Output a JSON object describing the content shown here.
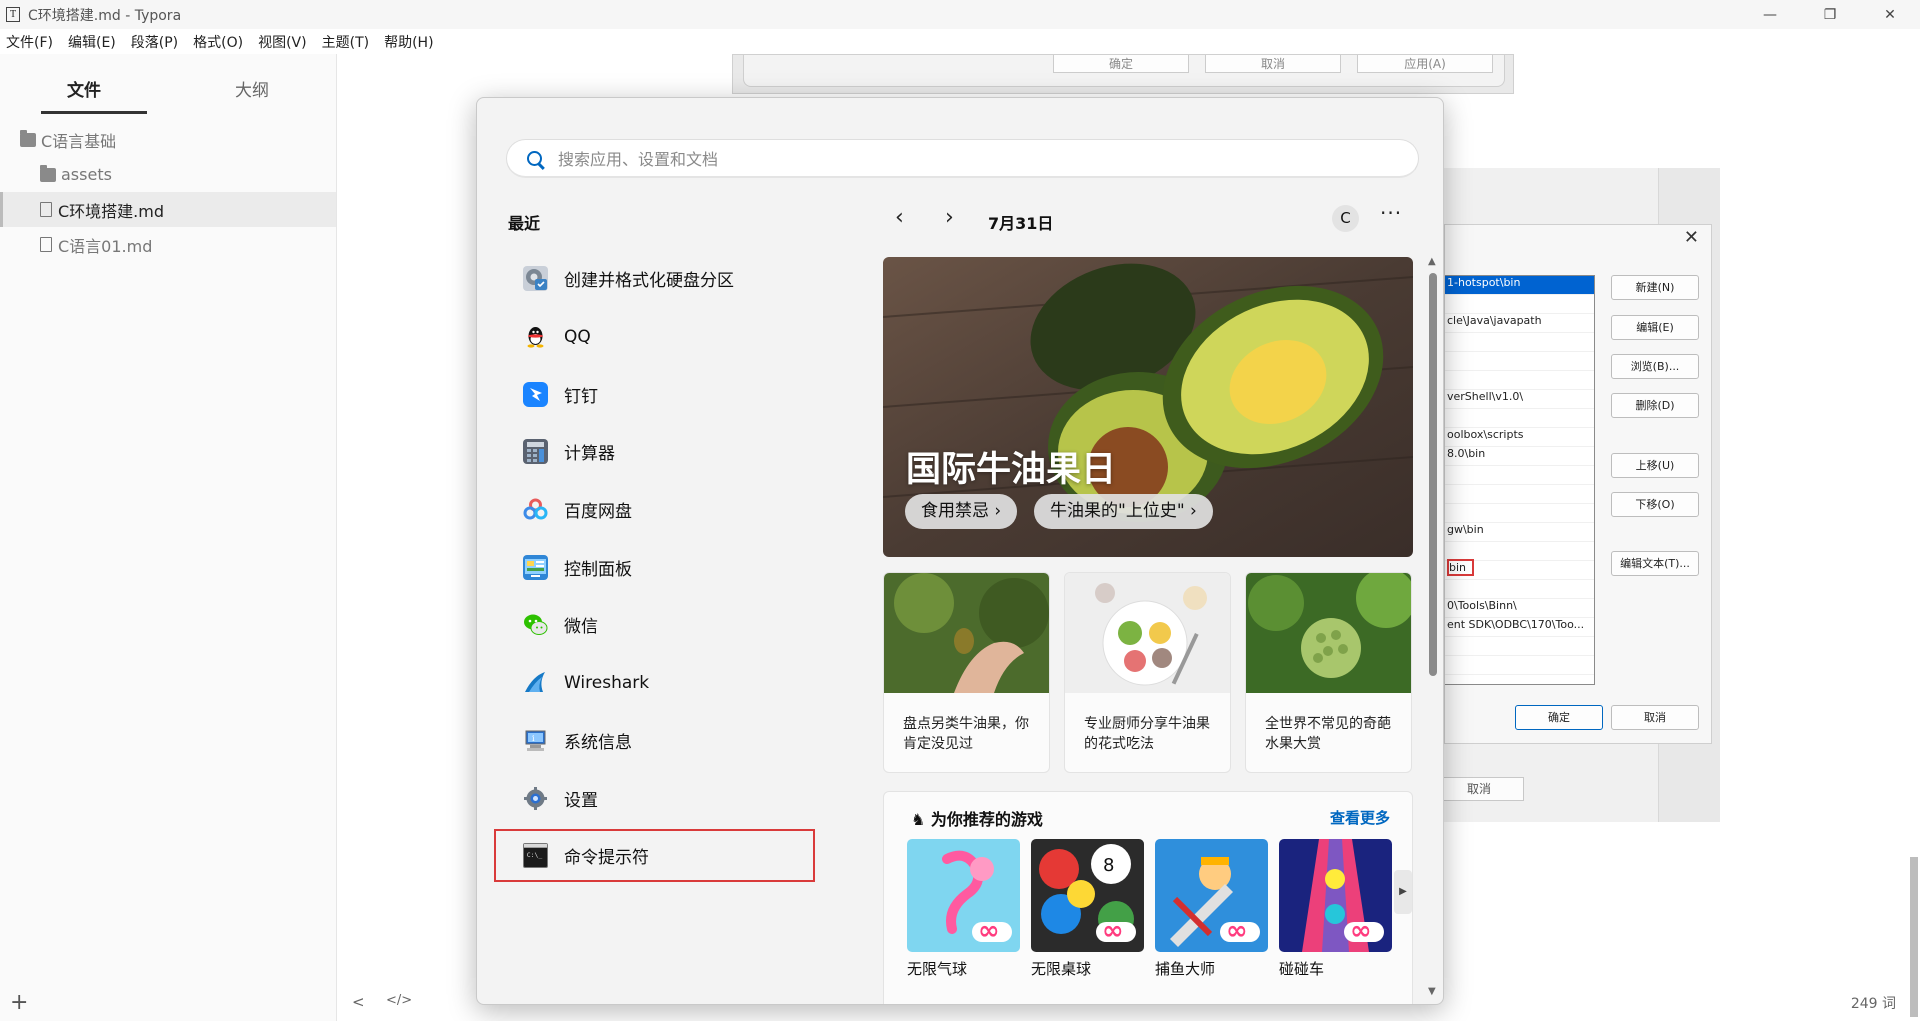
{
  "window": {
    "icon_letter": "T",
    "title": "C环境搭建.md - Typora",
    "minimize": "—",
    "maximize": "❐",
    "close": "✕"
  },
  "menu": [
    "文件(F)",
    "编辑(E)",
    "段落(P)",
    "格式(O)",
    "视图(V)",
    "主题(T)",
    "帮助(H)"
  ],
  "sidebar": {
    "tabs": [
      "文件",
      "大纲"
    ],
    "tree": [
      {
        "label": "C语言基础",
        "type": "folder"
      },
      {
        "label": "assets",
        "type": "folder"
      },
      {
        "label": "C环境搭建.md",
        "type": "file",
        "active": true
      },
      {
        "label": "C语言01.md",
        "type": "file"
      }
    ],
    "add": "+"
  },
  "statusbar": {
    "back": "<",
    "source": "</>",
    "word_count": "249 词"
  },
  "background": {
    "dialog_buttons": [
      "确定",
      "取消",
      "应用(A)"
    ],
    "env": {
      "rows": [
        "1-hotspot\\bin",
        "",
        "cle\\Java\\javapath",
        "",
        "",
        "",
        "verShell\\v1.0\\",
        "",
        "oolbox\\scripts",
        "8.0\\bin",
        "",
        "",
        "",
        "gw\\bin",
        "",
        "bin",
        "",
        "0\\Tools\\Binn\\",
        "ent SDK\\ODBC\\170\\Too...",
        "",
        ""
      ],
      "buttons": [
        "新建(N)",
        "编辑(E)",
        "浏览(B)...",
        "删除(D)",
        "上移(U)",
        "下移(O)",
        "编辑文本(T)..."
      ],
      "ok": "确定",
      "cancel": "取消"
    },
    "back_cancel": "取消"
  },
  "start": {
    "search_placeholder": "搜索应用、设置和文档",
    "recent_title": "最近",
    "apps": [
      {
        "label": "创建并格式化硬盘分区",
        "icon": "disk-management-icon"
      },
      {
        "label": "QQ",
        "icon": "qq-icon"
      },
      {
        "label": "钉钉",
        "icon": "dingtalk-icon"
      },
      {
        "label": "计算器",
        "icon": "calculator-icon"
      },
      {
        "label": "百度网盘",
        "icon": "baidu-netdisk-icon"
      },
      {
        "label": "控制面板",
        "icon": "control-panel-icon"
      },
      {
        "label": "微信",
        "icon": "wechat-icon"
      },
      {
        "label": "Wireshark",
        "icon": "wireshark-icon"
      },
      {
        "label": "系统信息",
        "icon": "system-info-icon"
      },
      {
        "label": "设置",
        "icon": "settings-icon"
      },
      {
        "label": "命令提示符",
        "icon": "cmd-icon"
      }
    ],
    "date": "7月31日",
    "avatar_letter": "C",
    "more": "···",
    "hero": {
      "title": "国际牛油果日",
      "chips": [
        "食用禁忌 ›",
        "牛油果的\"上位史\" ›"
      ]
    },
    "cards": [
      {
        "text": "盘点另类牛油果，你肯定没见过"
      },
      {
        "text": "专业厨师分享牛油果的花式吃法"
      },
      {
        "text": "全世界不常见的奇葩水果大赏"
      }
    ],
    "games": {
      "title": "为你推荐的游戏",
      "more": "查看更多",
      "items": [
        "无限气球",
        "无限桌球",
        "捕鱼大师",
        "碰碰车"
      ]
    }
  },
  "colors": {
    "accent": "#0067c0",
    "highlight_box": "#d93a3a"
  }
}
